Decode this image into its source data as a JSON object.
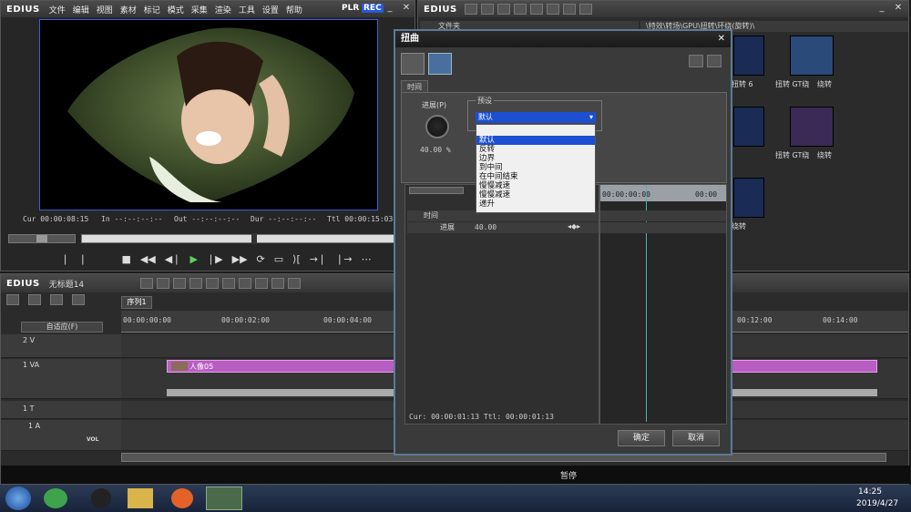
{
  "app": {
    "logo": "EDIUS",
    "menus": [
      "文件",
      "编辑",
      "视图",
      "素材",
      "标记",
      "模式",
      "采集",
      "渲染",
      "工具",
      "设置",
      "帮助"
    ],
    "plr": "PLR",
    "rec": "REC"
  },
  "player": {
    "cur_label": "Cur",
    "cur": "00:00:08:15",
    "in_label": "In",
    "in": "--:--:--:--",
    "out_label": "Out",
    "out": "--:--:--:--",
    "dur_label": "Dur",
    "dur": "--:--:--:--",
    "ttl_label": "Ttl",
    "ttl": "00:00:15:03"
  },
  "bin": {
    "logo": "EDIUS",
    "folder_label": "文件夹",
    "path": "\\特效\\转场\\GPU\\扭转\\环绕(旋转)\\",
    "thumbs": [
      {
        "caption": "扭转 6"
      },
      {
        "caption": "扭转 GT绕"
      },
      {
        "caption": "绕转"
      },
      {
        "caption": "扭转 GT绕"
      },
      {
        "caption": "绕转"
      },
      {
        "caption": "绕转"
      }
    ]
  },
  "dialog": {
    "title": "扭曲",
    "tab": "时间",
    "progress_label": "进展(P)",
    "progress_value": "40.00 %",
    "preset_label": "预设",
    "preset_selected": "默认",
    "preset_options": [
      "默认",
      "反转",
      "边界",
      "到中间",
      "在中间结束",
      "慢慢减速",
      "慢慢减速",
      "递升"
    ],
    "tree_time": "时间",
    "tree_progress": "进展",
    "tree_progress_value": "40.00",
    "timeline_tc": "00:00:00:00",
    "timeline_tc2": "00:00",
    "status": "Cur: 00:00:01:13  Ttl: 00:00:01:13",
    "ok": "确定",
    "cancel": "取消"
  },
  "timeline": {
    "logo": "EDIUS",
    "project": "无标题14",
    "sequence_tab": "序列1",
    "mode": "自适应(F)",
    "ruler": [
      "00:00:00:00",
      "00:00:02:00",
      "00:00:04:00",
      "00:12:00",
      "00:14:00"
    ],
    "tracks": [
      {
        "name": "2 V"
      },
      {
        "name": "1 VA"
      },
      {
        "name": "1 T"
      },
      {
        "name": "1 A"
      }
    ],
    "clip_label": "人像05",
    "pause": "暂停",
    "vol": "VOL"
  },
  "taskbar": {
    "time": "14:25",
    "date": "2019/4/27"
  },
  "colors": {
    "accent": "#1c4fd1",
    "clip": "#b85ec2",
    "dialog_border": "#5d7a96"
  }
}
